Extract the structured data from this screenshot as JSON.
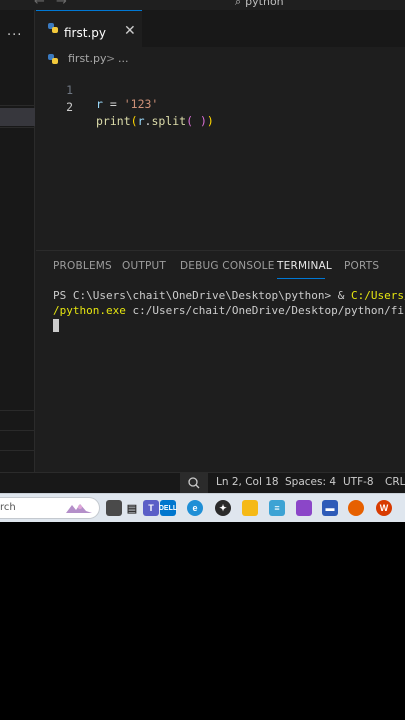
{
  "titlebar": {
    "command_center": "python",
    "back_icon": "arrow-left-icon",
    "forward_icon": "arrow-right-icon"
  },
  "sidebar": {
    "more_label": "..."
  },
  "editor": {
    "tab": {
      "label": "first.py",
      "close_glyph": "✕"
    },
    "breadcrumb": {
      "file": "first.py",
      "separator": ">",
      "more": "..."
    },
    "lines": [
      {
        "number": "1",
        "tokens": [
          "r",
          " = ",
          "'123'"
        ]
      },
      {
        "number": "2",
        "tokens": [
          "print",
          "(",
          "r",
          ".",
          "split",
          "(",
          " ",
          ")",
          ")"
        ]
      }
    ]
  },
  "panel": {
    "tabs": [
      "PROBLEMS",
      "OUTPUT",
      "DEBUG CONSOLE",
      "TERMINAL",
      "PORTS"
    ],
    "active_tab": "TERMINAL",
    "terminal": {
      "line1_prompt": "PS C:\\Users\\chait\\OneDrive\\Desktop\\python> & ",
      "line1_cmd": "C:/Users/c",
      "line2_cmd": "/python.exe",
      "line2_arg": " c:/Users/chait/OneDrive/Desktop/python/firs"
    }
  },
  "statusbar": {
    "position": "Ln 2, Col 18",
    "spaces": "Spaces: 4",
    "encoding": "UTF-8",
    "eol": "CRLF",
    "zoom_icon": "zoom-icon"
  },
  "taskbar": {
    "search_text": "rch",
    "apps": [
      "file-explorer-icon",
      "task-view-icon",
      "teams-icon",
      "dell-icon",
      "edge-icon",
      "chatgpt-icon",
      "folder-icon",
      "notepad-icon",
      "clipchamp-icon",
      "film-icon",
      "terminal-icon",
      "firefox-icon",
      "office-icon"
    ]
  },
  "colors": {
    "accent": "#0078d4",
    "editor_bg": "#1e1e1e",
    "taskbar_bg": "#dfe6ee"
  }
}
